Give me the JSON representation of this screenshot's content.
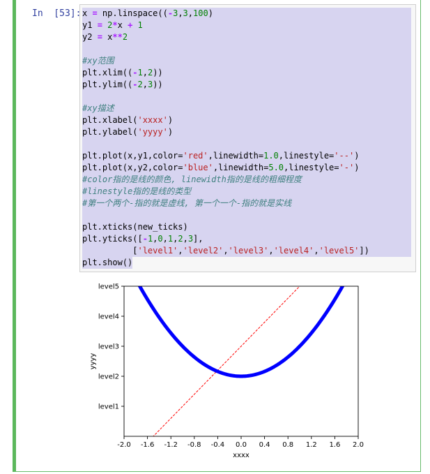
{
  "prompt": "In  [53]:",
  "code_lines": [
    [
      [
        "k",
        "x "
      ],
      [
        "o",
        "="
      ],
      [
        "k",
        " np.linspace(("
      ],
      [
        "o",
        "-"
      ],
      [
        "n",
        "3"
      ],
      [
        "k",
        ","
      ],
      [
        "n",
        "3"
      ],
      [
        "k",
        ","
      ],
      [
        "n",
        "100"
      ],
      [
        "k",
        ")"
      ]
    ],
    [
      [
        "k",
        "y1 "
      ],
      [
        "o",
        "="
      ],
      [
        "k",
        " "
      ],
      [
        "n",
        "2"
      ],
      [
        "o",
        "*"
      ],
      [
        "k",
        "x "
      ],
      [
        "o",
        "+"
      ],
      [
        "k",
        " "
      ],
      [
        "n",
        "1"
      ]
    ],
    [
      [
        "k",
        "y2 "
      ],
      [
        "o",
        "="
      ],
      [
        "k",
        " x"
      ],
      [
        "o",
        "**"
      ],
      [
        "n",
        "2"
      ]
    ],
    [],
    [
      [
        "c",
        "#xy范围"
      ]
    ],
    [
      [
        "k",
        "plt.xlim(("
      ],
      [
        "o",
        "-"
      ],
      [
        "n",
        "1"
      ],
      [
        "k",
        ","
      ],
      [
        "n",
        "2"
      ],
      [
        "k",
        "))"
      ]
    ],
    [
      [
        "k",
        "plt.ylim(("
      ],
      [
        "o",
        "-"
      ],
      [
        "n",
        "2"
      ],
      [
        "k",
        ","
      ],
      [
        "n",
        "3"
      ],
      [
        "k",
        "))"
      ]
    ],
    [],
    [
      [
        "c",
        "#xy描述"
      ]
    ],
    [
      [
        "k",
        "plt.xlabel("
      ],
      [
        "s",
        "'xxxx'"
      ],
      [
        "k",
        ")"
      ]
    ],
    [
      [
        "k",
        "plt.ylabel("
      ],
      [
        "s",
        "'yyyy'"
      ],
      [
        "k",
        ")"
      ]
    ],
    [],
    [
      [
        "k",
        "plt.plot(x,y1,color="
      ],
      [
        "s",
        "'red'"
      ],
      [
        "k",
        ",linewidth="
      ],
      [
        "n",
        "1.0"
      ],
      [
        "k",
        ",linestyle="
      ],
      [
        "s",
        "'--'"
      ],
      [
        "k",
        ")"
      ]
    ],
    [
      [
        "k",
        "plt.plot(x,y2,color="
      ],
      [
        "s",
        "'blue'"
      ],
      [
        "k",
        ",linewidth="
      ],
      [
        "n",
        "5.0"
      ],
      [
        "k",
        ",linestyle="
      ],
      [
        "s",
        "'-'"
      ],
      [
        "k",
        ")"
      ]
    ],
    [
      [
        "c",
        "#color指的是线的颜色, linewidth指的是线的粗细程度"
      ]
    ],
    [
      [
        "c",
        "#linestyle指的是线的类型"
      ]
    ],
    [
      [
        "c",
        "#第一个两个-指的就是虚线, 第一个一个-指的就是实线"
      ]
    ],
    [],
    [
      [
        "k",
        "plt.xticks(new_ticks)"
      ]
    ],
    [
      [
        "k",
        "plt.yticks(["
      ],
      [
        "o",
        "-"
      ],
      [
        "n",
        "1"
      ],
      [
        "k",
        ","
      ],
      [
        "n",
        "0"
      ],
      [
        "k",
        ","
      ],
      [
        "n",
        "1"
      ],
      [
        "k",
        ","
      ],
      [
        "n",
        "2"
      ],
      [
        "k",
        ","
      ],
      [
        "n",
        "3"
      ],
      [
        "k",
        "],"
      ]
    ],
    [
      [
        "k",
        "          ["
      ],
      [
        "s",
        "'level1'"
      ],
      [
        "k",
        ","
      ],
      [
        "s",
        "'level2'"
      ],
      [
        "k",
        ","
      ],
      [
        "s",
        "'level3'"
      ],
      [
        "k",
        ","
      ],
      [
        "s",
        "'level4'"
      ],
      [
        "k",
        ","
      ],
      [
        "s",
        "'level5'"
      ],
      [
        "k",
        "])"
      ]
    ],
    [
      [
        "k",
        "plt.show()"
      ]
    ]
  ],
  "colors": {
    "red_line": "#ff0000",
    "blue_line": "#0000ff",
    "cell_border": "#5cb85c",
    "selection": "#d7d4f0"
  },
  "chart_data": {
    "type": "line",
    "xlabel": "xxxx",
    "ylabel": "yyyy",
    "xlim": [
      -2.0,
      2.0
    ],
    "ylim": [
      -2,
      3
    ],
    "xticks": [
      "-2.0",
      "-1.6",
      "-1.2",
      "-0.8",
      "-0.4",
      "0.0",
      "0.4",
      "0.8",
      "1.2",
      "1.6",
      "2.0"
    ],
    "xtick_values": [
      -2.0,
      -1.6,
      -1.2,
      -0.8,
      -0.4,
      0.0,
      0.4,
      0.8,
      1.2,
      1.6,
      2.0
    ],
    "yticks": [
      "level1",
      "level2",
      "level3",
      "level4",
      "level5"
    ],
    "ytick_values": [
      -1,
      0,
      1,
      2,
      3
    ],
    "series": [
      {
        "color": "#ff0000",
        "linestyle": "dashed",
        "linewidth": 1.0,
        "function": "y1 = 2*x + 1"
      },
      {
        "color": "#0000ff",
        "linestyle": "solid",
        "linewidth": 5.0,
        "function": "y2 = x**2"
      }
    ]
  }
}
